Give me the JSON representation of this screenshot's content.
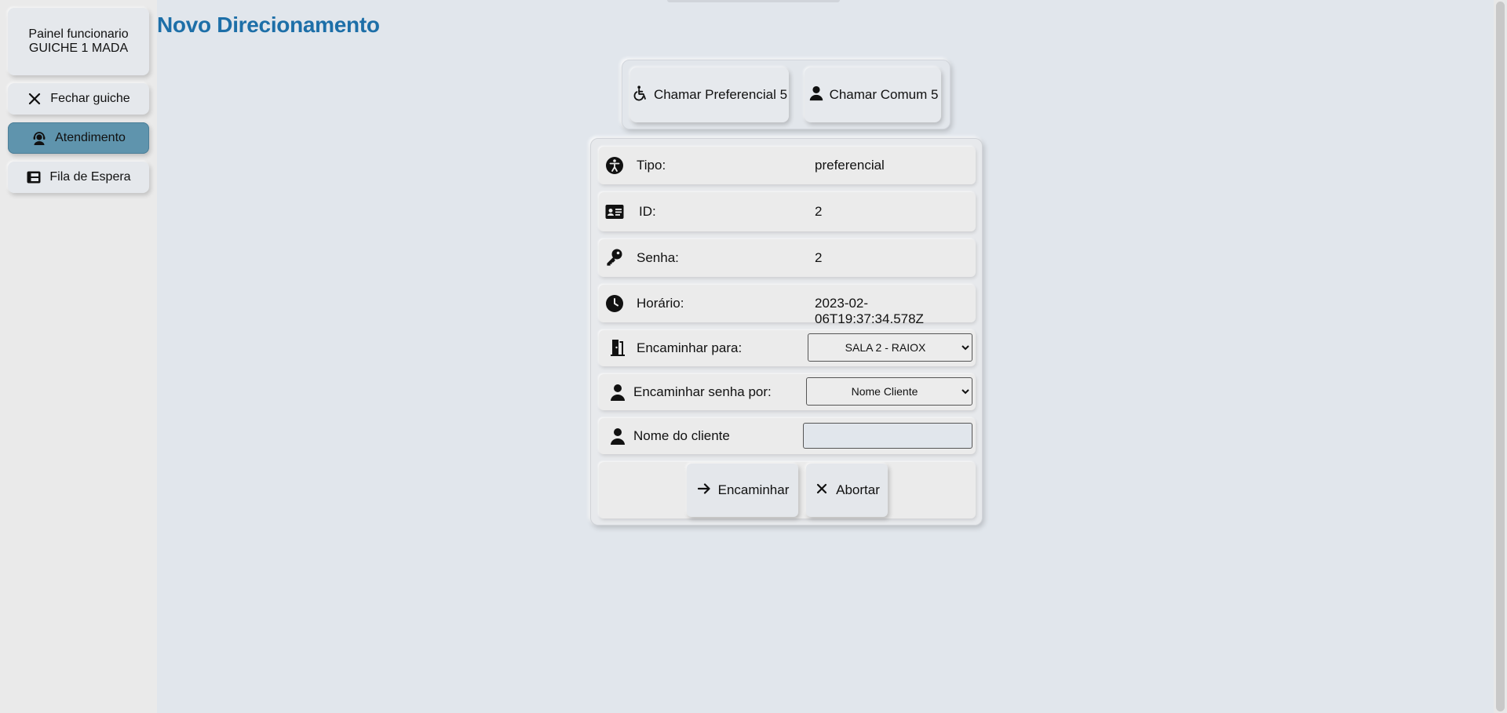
{
  "sidebar": {
    "header_line1": "Painel funcionario",
    "header_line2": "GUICHE 1 MADA",
    "items": [
      {
        "label": "Fechar guiche",
        "icon": "close-icon"
      },
      {
        "label": "Atendimento",
        "icon": "headset-user-icon",
        "active": true
      },
      {
        "label": "Fila de Espera",
        "icon": "list-icon"
      }
    ]
  },
  "page": {
    "title": "Novo Direcionamento"
  },
  "call": {
    "preferencial_label": "Chamar Preferencial 5",
    "comum_label": "Chamar Comum 5"
  },
  "form": {
    "tipo_label": "Tipo:",
    "tipo_value": "preferencial",
    "id_label": "ID:",
    "id_value": "2",
    "senha_label": "Senha:",
    "senha_value": "2",
    "horario_label": "Horário:",
    "horario_value": "2023-02-06T19:37:34.578Z",
    "encaminhar_para_label": "Encaminhar para:",
    "encaminhar_para_value": "SALA 2 - RAIOX",
    "encaminhar_por_label": "Encaminhar senha por:",
    "encaminhar_por_value": "Nome Cliente",
    "nome_cliente_label": "Nome do cliente",
    "nome_cliente_value": ""
  },
  "actions": {
    "encaminhar_label": "Encaminhar",
    "abortar_label": "Abortar"
  },
  "colors": {
    "accent": "#1d6fa8",
    "active_item": "#5f94ad",
    "background": "#e1e6ec"
  }
}
